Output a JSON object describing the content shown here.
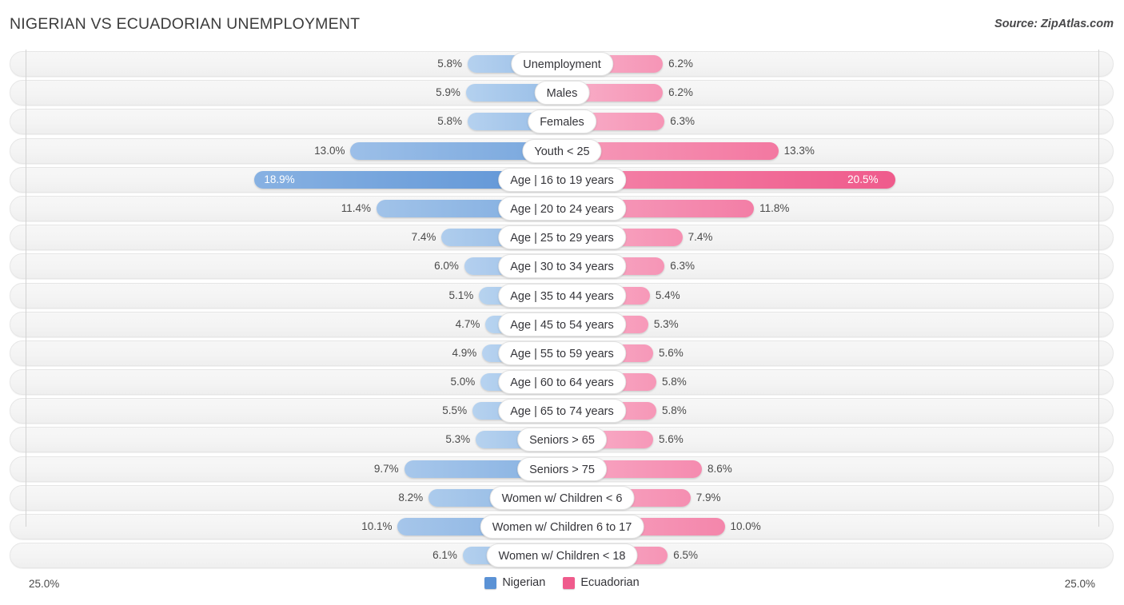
{
  "header": {
    "title": "NIGERIAN VS ECUADORIAN UNEMPLOYMENT",
    "source": "Source: ZipAtlas.com"
  },
  "axis": {
    "left_label": "25.0%",
    "right_label": "25.0%",
    "max": 25.0
  },
  "legend": {
    "items": [
      {
        "label": "Nigerian",
        "color": "#5b92d5"
      },
      {
        "label": "Ecuadorian",
        "color": "#ef5b8c"
      }
    ]
  },
  "colors": {
    "nigerian_light": "#a7c9ec",
    "nigerian_dark": "#5b92d5",
    "ecuadorian_light": "#f7a8c4",
    "ecuadorian_dark": "#ef5b8c",
    "track": "#f4f4f4",
    "axis_line": "#d2d2d2",
    "text": "#4a4a4a"
  },
  "chart_data": {
    "type": "bar",
    "orientation": "diverging-horizontal",
    "title": "NIGERIAN VS ECUADORIAN UNEMPLOYMENT",
    "xlabel": "",
    "ylabel": "",
    "xlim": [
      25.0,
      25.0
    ],
    "grid": false,
    "legend_position": "bottom-center",
    "categories": [
      "Unemployment",
      "Males",
      "Females",
      "Youth < 25",
      "Age | 16 to 19 years",
      "Age | 20 to 24 years",
      "Age | 25 to 29 years",
      "Age | 30 to 34 years",
      "Age | 35 to 44 years",
      "Age | 45 to 54 years",
      "Age | 55 to 59 years",
      "Age | 60 to 64 years",
      "Age | 65 to 74 years",
      "Seniors > 65",
      "Seniors > 75",
      "Women w/ Children < 6",
      "Women w/ Children 6 to 17",
      "Women w/ Children < 18"
    ],
    "series": [
      {
        "name": "Nigerian",
        "side": "left",
        "color": "#5b92d5",
        "values": [
          5.8,
          5.9,
          5.8,
          13.0,
          18.9,
          11.4,
          7.4,
          6.0,
          5.1,
          4.7,
          4.9,
          5.0,
          5.5,
          5.3,
          9.7,
          8.2,
          10.1,
          6.1
        ],
        "labels": [
          "5.8%",
          "5.9%",
          "5.8%",
          "13.0%",
          "18.9%",
          "11.4%",
          "7.4%",
          "6.0%",
          "5.1%",
          "4.7%",
          "4.9%",
          "5.0%",
          "5.5%",
          "5.3%",
          "9.7%",
          "8.2%",
          "10.1%",
          "6.1%"
        ]
      },
      {
        "name": "Ecuadorian",
        "side": "right",
        "color": "#ef5b8c",
        "values": [
          6.2,
          6.2,
          6.3,
          13.3,
          20.5,
          11.8,
          7.4,
          6.3,
          5.4,
          5.3,
          5.6,
          5.8,
          5.8,
          5.6,
          8.6,
          7.9,
          10.0,
          6.5
        ],
        "labels": [
          "6.2%",
          "6.2%",
          "6.3%",
          "13.3%",
          "20.5%",
          "11.8%",
          "7.4%",
          "6.3%",
          "5.4%",
          "5.3%",
          "5.6%",
          "5.8%",
          "5.8%",
          "5.6%",
          "8.6%",
          "7.9%",
          "10.0%",
          "6.5%"
        ]
      }
    ]
  }
}
